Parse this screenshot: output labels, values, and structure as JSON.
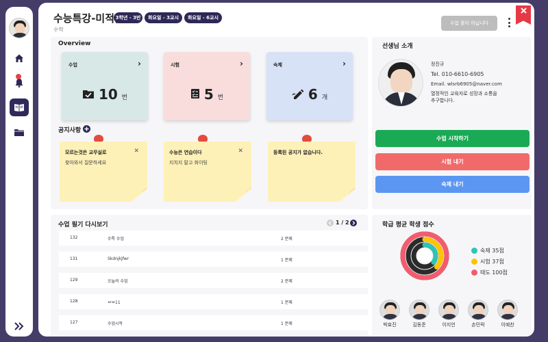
{
  "header": {
    "title": "수능특강-미적분",
    "subject": "수학",
    "badges": [
      "3학년 - 3반",
      "화요일 - 3교시",
      "화요일 - 6교시"
    ],
    "status_button": "수업 중이 아닙니다"
  },
  "overview": {
    "title": "Overview",
    "cards": [
      {
        "label": "수업",
        "value": "10",
        "unit": "번",
        "color": "#d8e8e6"
      },
      {
        "label": "시험",
        "value": "5",
        "unit": "번",
        "color": "#f9dddd"
      },
      {
        "label": "숙제",
        "value": "6",
        "unit": "개",
        "color": "#d8e2f6"
      }
    ]
  },
  "notices": {
    "title": "공지사항",
    "items": [
      {
        "title": "모르는것은 교무실로",
        "text": "찾아와서 질문하세요"
      },
      {
        "title": "수능은 연습이다",
        "text": "지치지 말고 화이팅"
      },
      {
        "title": "등록된 공지가 없습니다.",
        "text": ""
      }
    ]
  },
  "teacher": {
    "section_title": "선생님 소개",
    "name": "정진규",
    "tel": "Tel. 010-6610-6905",
    "email": "Email. wlsrb6905@naver.com",
    "bio_line1": "열정적인 교육자로 성장과 소통을",
    "bio_line2": "추구합니다."
  },
  "actions": {
    "start": "수업 시작하기",
    "exam": "시험 내기",
    "homework": "숙제 내기"
  },
  "notes_list": {
    "title": "수업 필기 다시보기",
    "page": "1 / 2",
    "rows": [
      {
        "id": "132",
        "name": "수특 수업",
        "count": "2 문제"
      },
      {
        "id": "131",
        "name": "Skdnjkjfwr",
        "count": "1 문제"
      },
      {
        "id": "129",
        "name": "오늘의 수업",
        "count": "2 문제"
      },
      {
        "id": "128",
        "name": "ㅂㅂ11",
        "count": "1 문제"
      },
      {
        "id": "127",
        "name": "수업시작",
        "count": "1 문제"
      }
    ]
  },
  "scores": {
    "title": "학급 평균 학생 점수",
    "legend": [
      {
        "label": "숙제 35점",
        "value": 35,
        "color": "#2ec4b6"
      },
      {
        "label": "시험 37점",
        "value": 37,
        "color": "#ffc300"
      },
      {
        "label": "태도 100점",
        "value": 100,
        "color": "#f25c6e"
      }
    ],
    "students": [
      "박효진",
      "김동준",
      "이지언",
      "손민락",
      "이예찬"
    ]
  }
}
